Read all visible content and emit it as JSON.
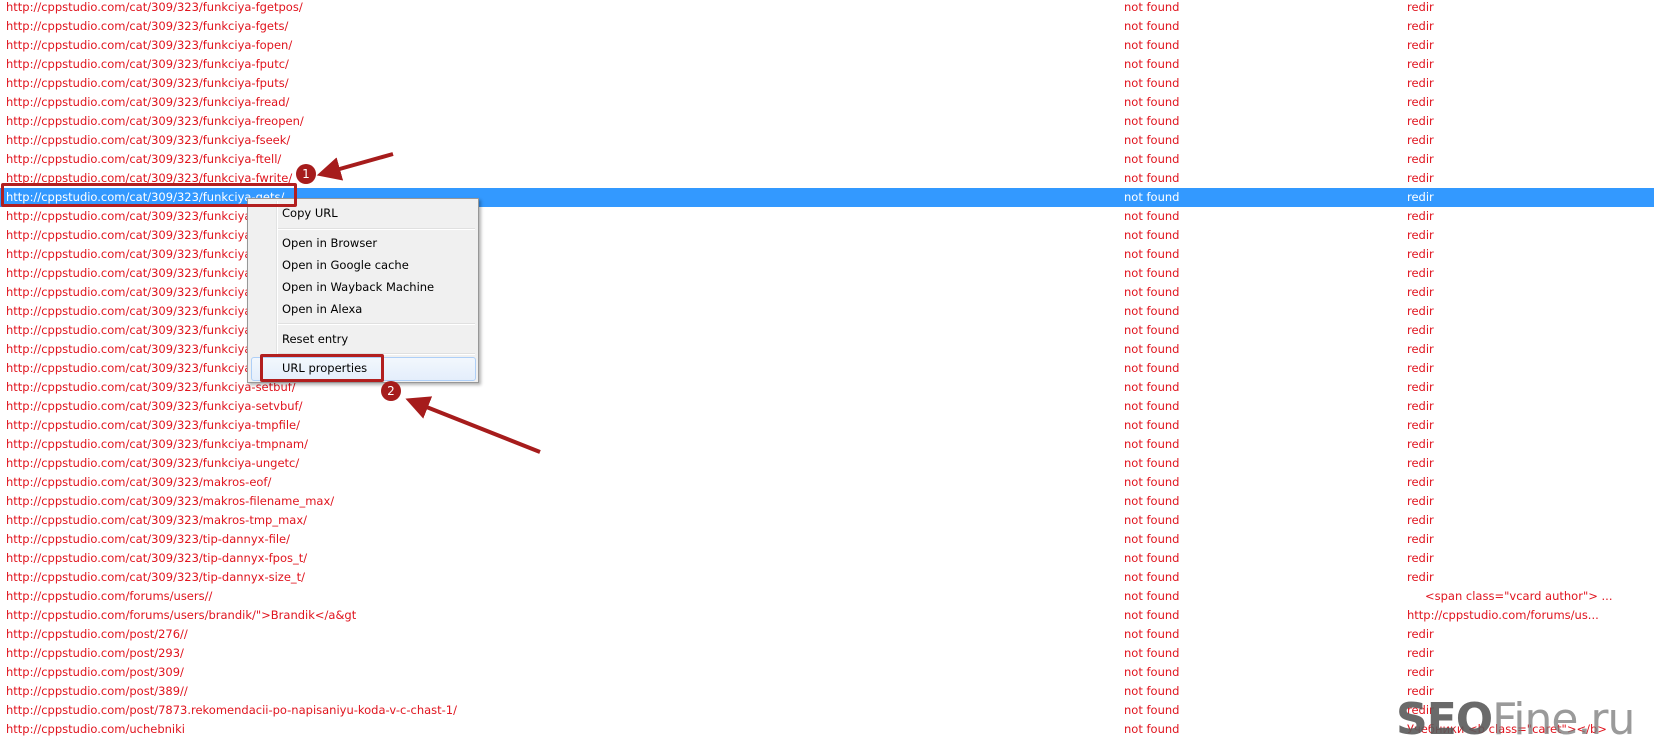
{
  "colors": {
    "text": "#e0141e",
    "selection": "#3399ff",
    "annotation": "#a61c1c"
  },
  "rows": [
    {
      "url": "http://cppstudio.com/cat/309/323/funkciya-fgetpos/",
      "status": "not found",
      "info": "redir"
    },
    {
      "url": "http://cppstudio.com/cat/309/323/funkciya-fgets/",
      "status": "not found",
      "info": "redir"
    },
    {
      "url": "http://cppstudio.com/cat/309/323/funkciya-fopen/",
      "status": "not found",
      "info": "redir"
    },
    {
      "url": "http://cppstudio.com/cat/309/323/funkciya-fputc/",
      "status": "not found",
      "info": "redir"
    },
    {
      "url": "http://cppstudio.com/cat/309/323/funkciya-fputs/",
      "status": "not found",
      "info": "redir"
    },
    {
      "url": "http://cppstudio.com/cat/309/323/funkciya-fread/",
      "status": "not found",
      "info": "redir"
    },
    {
      "url": "http://cppstudio.com/cat/309/323/funkciya-freopen/",
      "status": "not found",
      "info": "redir"
    },
    {
      "url": "http://cppstudio.com/cat/309/323/funkciya-fseek/",
      "status": "not found",
      "info": "redir"
    },
    {
      "url": "http://cppstudio.com/cat/309/323/funkciya-ftell/",
      "status": "not found",
      "info": "redir"
    },
    {
      "url": "http://cppstudio.com/cat/309/323/funkciya-fwrite/",
      "status": "not found",
      "info": "redir"
    },
    {
      "url": "http://cppstudio.com/cat/309/323/funkciya-gets/",
      "status": "not found",
      "info": "redir",
      "selected": true
    },
    {
      "url": "http://cppstudio.com/cat/309/323/funkciya-g",
      "status": "not found",
      "info": "redir"
    },
    {
      "url": "http://cppstudio.com/cat/309/323/funkciya-g",
      "status": "not found",
      "info": "redir"
    },
    {
      "url": "http://cppstudio.com/cat/309/323/funkciya-p",
      "status": "not found",
      "info": "redir"
    },
    {
      "url": "http://cppstudio.com/cat/309/323/funkciya-p",
      "status": "not found",
      "info": "redir"
    },
    {
      "url": "http://cppstudio.com/cat/309/323/funkciya-p",
      "status": "not found",
      "info": "redir"
    },
    {
      "url": "http://cppstudio.com/cat/309/323/funkciya-p",
      "status": "not found",
      "info": "redir"
    },
    {
      "url": "http://cppstudio.com/cat/309/323/funkciya-r",
      "status": "not found",
      "info": "redir"
    },
    {
      "url": "http://cppstudio.com/cat/309/323/funkciya-r",
      "status": "not found",
      "info": "redir"
    },
    {
      "url": "http://cppstudio.com/cat/309/323/funkciya-r",
      "status": "not found",
      "info": "redir"
    },
    {
      "url": "http://cppstudio.com/cat/309/323/funkciya-setbuf/",
      "status": "not found",
      "info": "redir"
    },
    {
      "url": "http://cppstudio.com/cat/309/323/funkciya-setvbuf/",
      "status": "not found",
      "info": "redir"
    },
    {
      "url": "http://cppstudio.com/cat/309/323/funkciya-tmpfile/",
      "status": "not found",
      "info": "redir"
    },
    {
      "url": "http://cppstudio.com/cat/309/323/funkciya-tmpnam/",
      "status": "not found",
      "info": "redir"
    },
    {
      "url": "http://cppstudio.com/cat/309/323/funkciya-ungetc/",
      "status": "not found",
      "info": "redir"
    },
    {
      "url": "http://cppstudio.com/cat/309/323/makros-eof/",
      "status": "not found",
      "info": "redir"
    },
    {
      "url": "http://cppstudio.com/cat/309/323/makros-filename_max/",
      "status": "not found",
      "info": "redir"
    },
    {
      "url": "http://cppstudio.com/cat/309/323/makros-tmp_max/",
      "status": "not found",
      "info": "redir"
    },
    {
      "url": "http://cppstudio.com/cat/309/323/tip-dannyx-file/",
      "status": "not found",
      "info": "redir"
    },
    {
      "url": "http://cppstudio.com/cat/309/323/tip-dannyx-fpos_t/",
      "status": "not found",
      "info": "redir"
    },
    {
      "url": "http://cppstudio.com/cat/309/323/tip-dannyx-size_t/",
      "status": "not found",
      "info": "redir"
    },
    {
      "url": "http://cppstudio.com/forums/users//",
      "status": "not found",
      "info": "<span class=\"vcard author\">   ...",
      "indent": true
    },
    {
      "url": "http://cppstudio.com/forums/users/brandik/\">Brandik</a&gt",
      "status": "not found",
      "info": "http://cppstudio.com/forums/us..."
    },
    {
      "url": "http://cppstudio.com/post/276//",
      "status": "not found",
      "info": "redir"
    },
    {
      "url": "http://cppstudio.com/post/293/",
      "status": "not found",
      "info": "redir"
    },
    {
      "url": "http://cppstudio.com/post/309/",
      "status": "not found",
      "info": "redir"
    },
    {
      "url": "http://cppstudio.com/post/389//",
      "status": "not found",
      "info": "redir"
    },
    {
      "url": "http://cppstudio.com/post/7873.rekomendacii-po-napisaniyu-koda-v-c-chast-1/",
      "status": "not found",
      "info": "redir"
    },
    {
      "url": "http://cppstudio.com/uchebniki",
      "status": "not found",
      "info": "Учебники <b class=\"caret\"></b>"
    }
  ],
  "context_menu": {
    "copy_url": "Copy URL",
    "open_browser": "Open in Browser",
    "open_google_cache": "Open in Google cache",
    "open_wayback": "Open in Wayback Machine",
    "open_alexa": "Open in Alexa",
    "reset_entry": "Reset entry",
    "url_properties": "URL properties"
  },
  "annotations": {
    "step1": "1",
    "step2": "2"
  },
  "watermark": {
    "bold": "SEO",
    "rest": "Fine.ru"
  }
}
